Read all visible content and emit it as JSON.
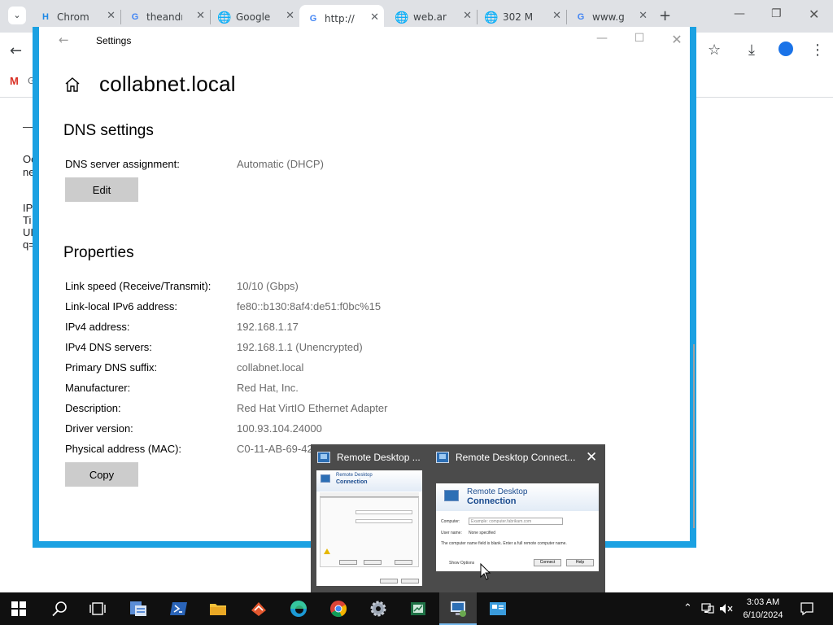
{
  "chrome": {
    "tabs": [
      {
        "title": "Chrom",
        "icon": "hackmd-icon"
      },
      {
        "title": "theandr",
        "icon": "google-icon"
      },
      {
        "title": "Google",
        "icon": "globe-icon"
      },
      {
        "title": "http://",
        "icon": "google-icon"
      },
      {
        "title": "web.ar",
        "icon": "globe-icon"
      },
      {
        "title": "302 M",
        "icon": "globe-icon"
      },
      {
        "title": "www.g",
        "icon": "google-icon"
      }
    ],
    "bookmark_fragment": "G",
    "page_fragments": [
      "Oc",
      "ne",
      "IP",
      "Ti",
      "UI",
      "q="
    ]
  },
  "settings": {
    "window_title": "Settings",
    "page_title": "collabnet.local",
    "dns_heading": "DNS settings",
    "dns_assignment_label": "DNS server assignment:",
    "dns_assignment_value": "Automatic (DHCP)",
    "edit_label": "Edit",
    "properties_heading": "Properties",
    "properties": [
      {
        "label": "Link speed (Receive/Transmit):",
        "value": "10/10 (Gbps)"
      },
      {
        "label": "Link-local IPv6 address:",
        "value": "fe80::b130:8af4:de51:f0bc%15"
      },
      {
        "label": "IPv4 address:",
        "value": "192.168.1.17"
      },
      {
        "label": "IPv4 DNS servers:",
        "value": "192.168.1.1 (Unencrypted)"
      },
      {
        "label": "Primary DNS suffix:",
        "value": "collabnet.local"
      },
      {
        "label": "Manufacturer:",
        "value": "Red Hat, Inc."
      },
      {
        "label": "Description:",
        "value": "Red Hat VirtIO Ethernet Adapter"
      },
      {
        "label": "Driver version:",
        "value": "100.93.104.24000"
      },
      {
        "label": "Physical address (MAC):",
        "value": "C0-11-AB-69-42"
      }
    ],
    "copy_label": "Copy"
  },
  "preview": {
    "items": [
      {
        "title": "Remote Desktop ..."
      },
      {
        "title": "Remote Desktop Connect..."
      }
    ],
    "thumb_header_line1": "Remote Desktop",
    "thumb_header_line2": "Connection",
    "thumb2_computer_label": "Computer:",
    "thumb2_computer_placeholder": "Example: computer.fabrikam.com",
    "thumb2_username_label": "User name:",
    "thumb2_username_value": "None specified",
    "thumb2_message": "The computer name field is blank. Enter a full remote computer name.",
    "thumb2_show_options": "Show Options",
    "thumb2_connect": "Connect",
    "thumb2_help": "Help"
  },
  "taskbar": {
    "time": "3:03 AM",
    "date": "6/10/2024"
  },
  "colors": {
    "accent": "#1ba1e2",
    "button_gray": "#cccccc",
    "value_gray": "#6b6b6b",
    "taskbar": "#101010"
  }
}
